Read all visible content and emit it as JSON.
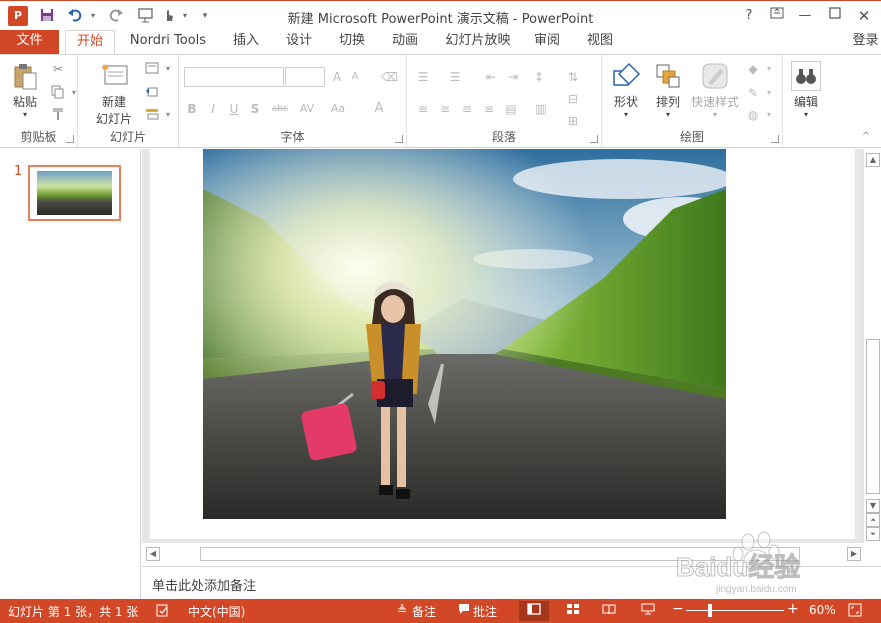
{
  "window": {
    "title": "新建 Microsoft PowerPoint 演示文稿 - PowerPoint",
    "help": "?",
    "logo_text": "P"
  },
  "tabs": [
    {
      "label": "文件"
    },
    {
      "label": "开始"
    },
    {
      "label": "Nordri Tools"
    },
    {
      "label": "插入"
    },
    {
      "label": "设计"
    },
    {
      "label": "切换"
    },
    {
      "label": "动画"
    },
    {
      "label": "幻灯片放映"
    },
    {
      "label": "审阅"
    },
    {
      "label": "视图"
    }
  ],
  "login": "登录",
  "ribbon": {
    "clipboard": {
      "label": "剪贴板",
      "paste": "粘贴"
    },
    "slides": {
      "label": "幻灯片",
      "new_slide_line1": "新建",
      "new_slide_line2": "幻灯片"
    },
    "font": {
      "label": "字体"
    },
    "paragraph": {
      "label": "段落"
    },
    "drawing": {
      "label": "绘图",
      "shapes": "形状",
      "arrange": "排列",
      "quick_styles": "快速样式"
    },
    "editing": {
      "label": "编辑"
    }
  },
  "slides_pane": {
    "number": "1"
  },
  "notes": {
    "placeholder": "单击此处添加备注"
  },
  "status": {
    "slide_info": "幻灯片 第 1 张，共 1 张",
    "language": "中文(中国)",
    "notes": "备注",
    "comments": "批注",
    "zoom": "60%",
    "zoom_fraction": 0.24
  },
  "watermark": {
    "text": "Baidu经验",
    "sub": "jingyan.baidu.com"
  },
  "colors": {
    "accent": "#d24726"
  }
}
